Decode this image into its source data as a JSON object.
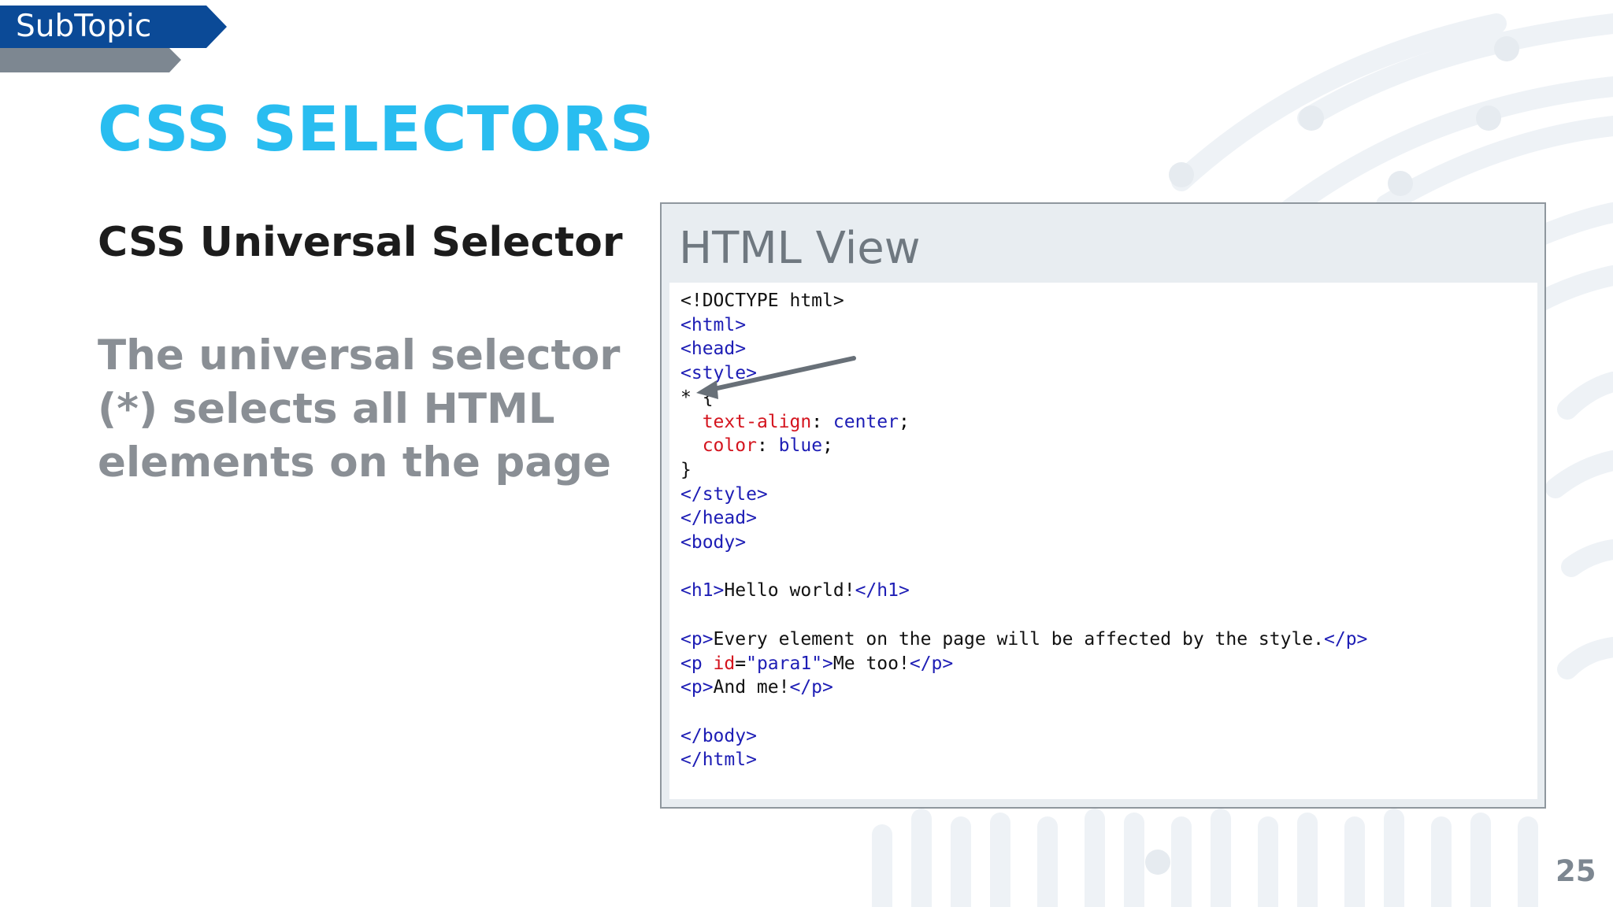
{
  "slide": {
    "subtopic_label": "SubTopic",
    "title": "CSS SELECTORS",
    "section_heading": "CSS Universal Selector",
    "description": "The universal selector (*) selects all HTML elements on the page",
    "page_number": "25"
  },
  "panel": {
    "title": "HTML View"
  },
  "code": {
    "line1": "<!DOCTYPE html>",
    "line2": "<html>",
    "line3": "<head>",
    "line4": "<style>",
    "line5_selector": "* {",
    "line6_prop": "text-align",
    "line6_val": "center",
    "line7_prop": "color",
    "line7_val": "blue",
    "line8": "}",
    "line9": "</style>",
    "line10": "</head>",
    "line11": "<body>",
    "line13_open": "<h1>",
    "line13_text": "Hello world!",
    "line13_close": "</h1>",
    "line15_open": "<p>",
    "line15_text": "Every element on the page will be affected by the style.",
    "line15_close": "</p>",
    "line16_open": "<p ",
    "line16_attr": "id",
    "line16_attrval": "\"para1\"",
    "line16_text": "Me too!",
    "line16_close": "</p>",
    "line17_open": "<p>",
    "line17_text": "And me!",
    "line17_close": "</p>",
    "line19": "</body>",
    "line20": "</html>"
  },
  "colors": {
    "title": "#29bdf0",
    "subtopic_tab": "#0b4a97",
    "subtopic_underbar": "#7d8791",
    "tag": "#1d1db5",
    "property": "#d4141e",
    "arrow": "#687078"
  }
}
